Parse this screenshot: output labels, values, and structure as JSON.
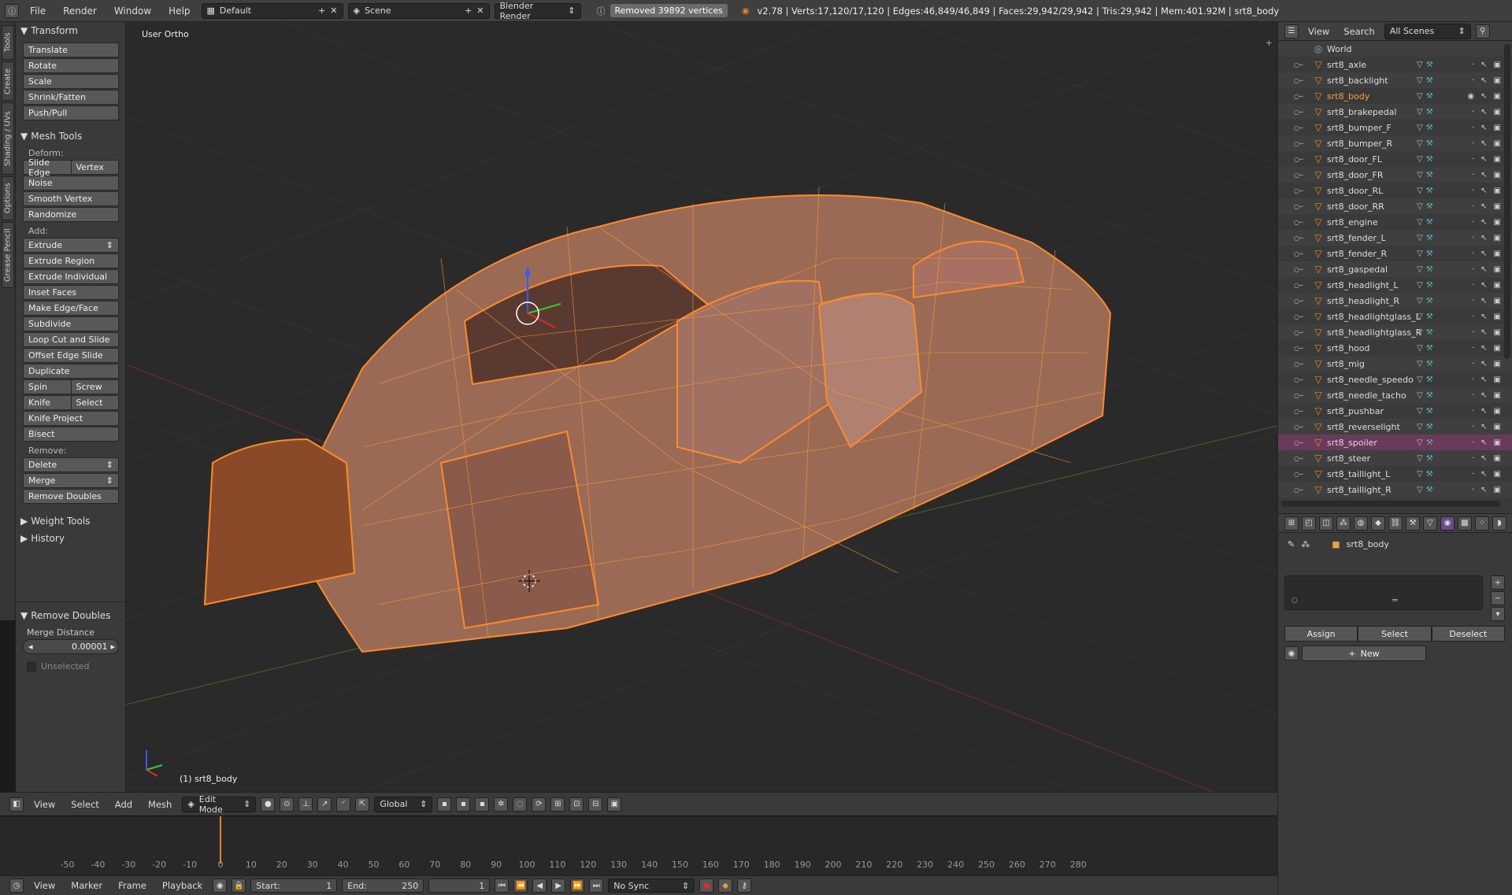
{
  "topbar": {
    "menus": [
      "File",
      "Render",
      "Window",
      "Help"
    ],
    "screen_layout": "Default",
    "scene": "Scene",
    "render_engine": "Blender Render",
    "report": "Removed 39892 vertices",
    "stats": "v2.78 | Verts:17,120/17,120 | Edges:46,849/46,849 | Faces:29,942/29,942 | Tris:29,942 | Mem:401.92M | srt8_body"
  },
  "tool_tabs": [
    "Tools",
    "Create",
    "Shading / UVs",
    "Options",
    "Grease Pencil"
  ],
  "tools": {
    "transform_title": "Transform",
    "transform_buttons": [
      "Translate",
      "Rotate",
      "Scale",
      "Shrink/Fatten",
      "Push/Pull"
    ],
    "mesh_tools_title": "Mesh Tools",
    "deform_label": "Deform:",
    "slide_edge": "Slide Edge",
    "vertex": "Vertex",
    "deform_buttons": [
      "Noise",
      "Smooth Vertex",
      "Randomize"
    ],
    "add_label": "Add:",
    "extrude": "Extrude",
    "add_buttons": [
      "Extrude Region",
      "Extrude Individual",
      "Inset Faces",
      "Make Edge/Face",
      "Subdivide",
      "Loop Cut and Slide",
      "Offset Edge Slide",
      "Duplicate"
    ],
    "spin": "Spin",
    "screw": "Screw",
    "knife": "Knife",
    "select": "Select",
    "knife_project": "Knife Project",
    "bisect": "Bisect",
    "remove_label": "Remove:",
    "delete": "Delete",
    "merge": "Merge",
    "remove_doubles": "Remove Doubles",
    "weight_tools": "Weight Tools",
    "history": "History",
    "operator_title": "Remove Doubles",
    "merge_distance_label": "Merge Distance",
    "merge_distance_value": "0.00001",
    "unselected_label": "Unselected"
  },
  "viewport": {
    "view_label": "User Ortho",
    "object_label": "(1) srt8_body"
  },
  "viewport_header": {
    "menus": [
      "View",
      "Select",
      "Add",
      "Mesh"
    ],
    "mode": "Edit Mode",
    "orientation": "Global"
  },
  "timeline": {
    "ticks": [
      "-50",
      "-40",
      "-30",
      "-20",
      "-10",
      "0",
      "10",
      "20",
      "30",
      "40",
      "50",
      "60",
      "70",
      "80",
      "90",
      "100",
      "110",
      "120",
      "130",
      "140",
      "150",
      "160",
      "170",
      "180",
      "190",
      "200",
      "210",
      "220",
      "230",
      "240",
      "250",
      "260",
      "270",
      "280"
    ],
    "current_frame_marker": 0
  },
  "timeline_footer": {
    "menus": [
      "View",
      "Marker",
      "Frame",
      "Playback"
    ],
    "start_label": "Start:",
    "start_value": "1",
    "end_label": "End:",
    "end_value": "250",
    "current": "1",
    "sync": "No Sync"
  },
  "outliner": {
    "menus": [
      "View",
      "Search"
    ],
    "filter": "All Scenes",
    "world": "World",
    "items": [
      {
        "name": "srt8_axle",
        "active": false,
        "hl": false
      },
      {
        "name": "srt8_backlight",
        "active": false,
        "hl": false
      },
      {
        "name": "srt8_body",
        "active": true,
        "hl": false
      },
      {
        "name": "srt8_brakepedal",
        "active": false,
        "hl": false
      },
      {
        "name": "srt8_bumper_F",
        "active": false,
        "hl": false
      },
      {
        "name": "srt8_bumper_R",
        "active": false,
        "hl": false
      },
      {
        "name": "srt8_door_FL",
        "active": false,
        "hl": false
      },
      {
        "name": "srt8_door_FR",
        "active": false,
        "hl": false
      },
      {
        "name": "srt8_door_RL",
        "active": false,
        "hl": false
      },
      {
        "name": "srt8_door_RR",
        "active": false,
        "hl": false
      },
      {
        "name": "srt8_engine",
        "active": false,
        "hl": false
      },
      {
        "name": "srt8_fender_L",
        "active": false,
        "hl": false
      },
      {
        "name": "srt8_fender_R",
        "active": false,
        "hl": false
      },
      {
        "name": "srt8_gaspedal",
        "active": false,
        "hl": false
      },
      {
        "name": "srt8_headlight_L",
        "active": false,
        "hl": false
      },
      {
        "name": "srt8_headlight_R",
        "active": false,
        "hl": false
      },
      {
        "name": "srt8_headlightglass_L",
        "active": false,
        "hl": false
      },
      {
        "name": "srt8_headlightglass_R",
        "active": false,
        "hl": false
      },
      {
        "name": "srt8_hood",
        "active": false,
        "hl": false
      },
      {
        "name": "srt8_mig",
        "active": false,
        "hl": false
      },
      {
        "name": "srt8_needle_speedo",
        "active": false,
        "hl": false
      },
      {
        "name": "srt8_needle_tacho",
        "active": false,
        "hl": false
      },
      {
        "name": "srt8_pushbar",
        "active": false,
        "hl": false
      },
      {
        "name": "srt8_reverselight",
        "active": false,
        "hl": false
      },
      {
        "name": "srt8_spoiler",
        "active": false,
        "hl": true
      },
      {
        "name": "srt8_steer",
        "active": false,
        "hl": false
      },
      {
        "name": "srt8_taillight_L",
        "active": false,
        "hl": false
      },
      {
        "name": "srt8_taillight_R",
        "active": false,
        "hl": false
      }
    ]
  },
  "properties": {
    "object_name": "srt8_body",
    "assign": "Assign",
    "select": "Select",
    "deselect": "Deselect",
    "new": "New"
  },
  "colors": {
    "accent": "#e8822a",
    "wire": "#ff8a2a",
    "highlight_row": "#6a3a5a"
  }
}
